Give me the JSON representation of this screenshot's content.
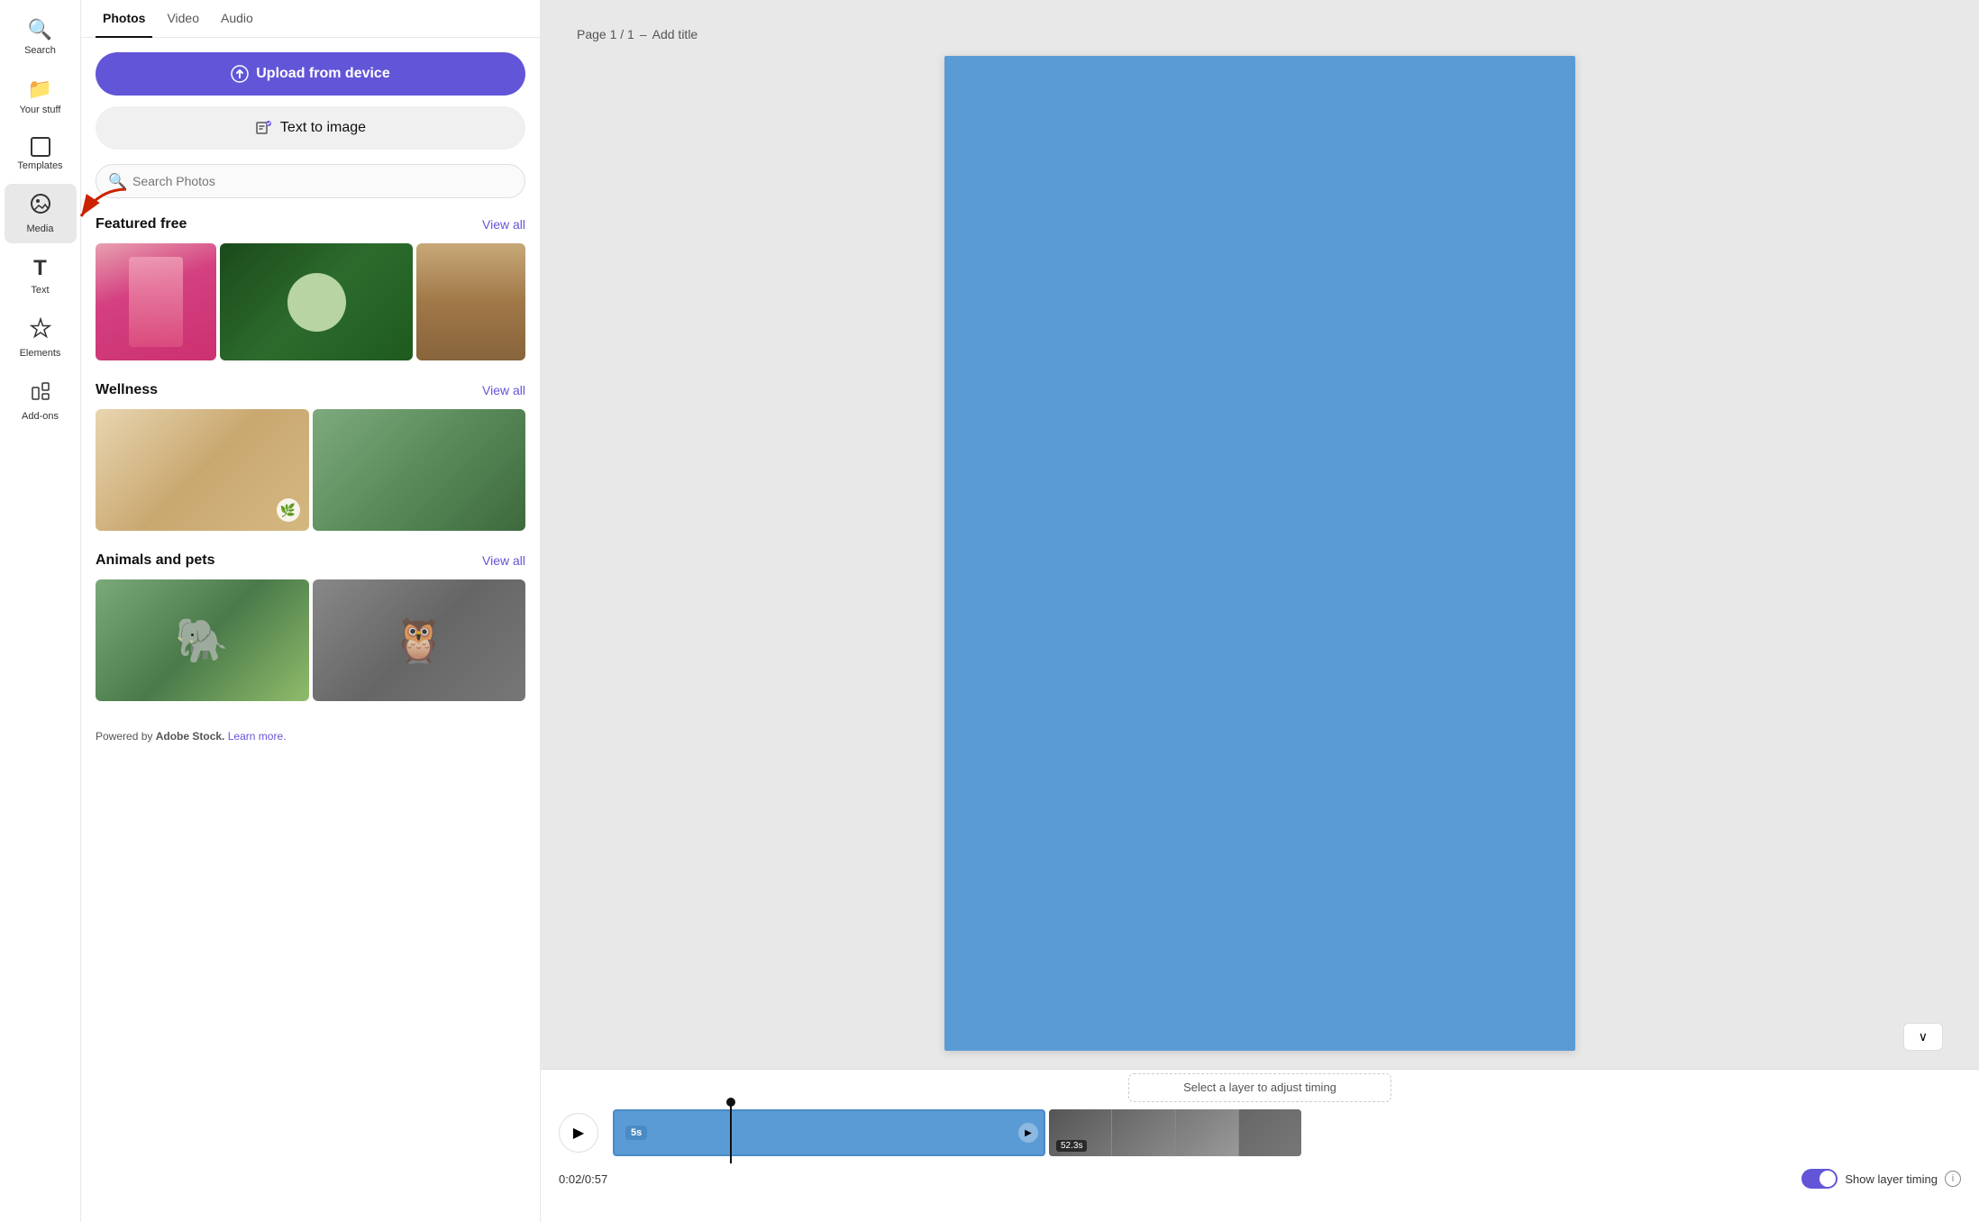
{
  "sidebar": {
    "items": [
      {
        "id": "search",
        "label": "Search",
        "icon": "🔍"
      },
      {
        "id": "your-stuff",
        "label": "Your stuff",
        "icon": "📁"
      },
      {
        "id": "templates",
        "label": "Templates",
        "icon": "◻"
      },
      {
        "id": "media",
        "label": "Media",
        "icon": "📷",
        "active": true
      },
      {
        "id": "text",
        "label": "Text",
        "icon": "T"
      },
      {
        "id": "elements",
        "label": "Elements",
        "icon": "🔔"
      },
      {
        "id": "add-ons",
        "label": "Add-ons",
        "icon": "🎁"
      }
    ]
  },
  "panel": {
    "tabs": [
      {
        "id": "photos",
        "label": "Photos",
        "active": true
      },
      {
        "id": "video",
        "label": "Video"
      },
      {
        "id": "audio",
        "label": "Audio"
      }
    ],
    "upload_btn_label": "Upload from device",
    "text_to_image_btn_label": "Text to image",
    "search_placeholder": "Search Photos",
    "sections": [
      {
        "id": "featured-free",
        "title": "Featured free",
        "view_all": "View all"
      },
      {
        "id": "wellness",
        "title": "Wellness",
        "view_all": "View all"
      },
      {
        "id": "animals-pets",
        "title": "Animals and pets",
        "view_all": "View all"
      }
    ],
    "powered_by": "Powered by",
    "adobe_stock": "Adobe Stock.",
    "learn_more": "Learn more."
  },
  "canvas": {
    "page_label": "Page 1 / 1",
    "separator": "–",
    "add_title": "Add title",
    "collapse_icon": "∨"
  },
  "timeline": {
    "hint": "Select a layer to adjust timing",
    "clip1_duration": "5s",
    "clip2_duration": "52.3s",
    "time_display": "0:02/0:57",
    "show_timing_label": "Show layer timing"
  }
}
